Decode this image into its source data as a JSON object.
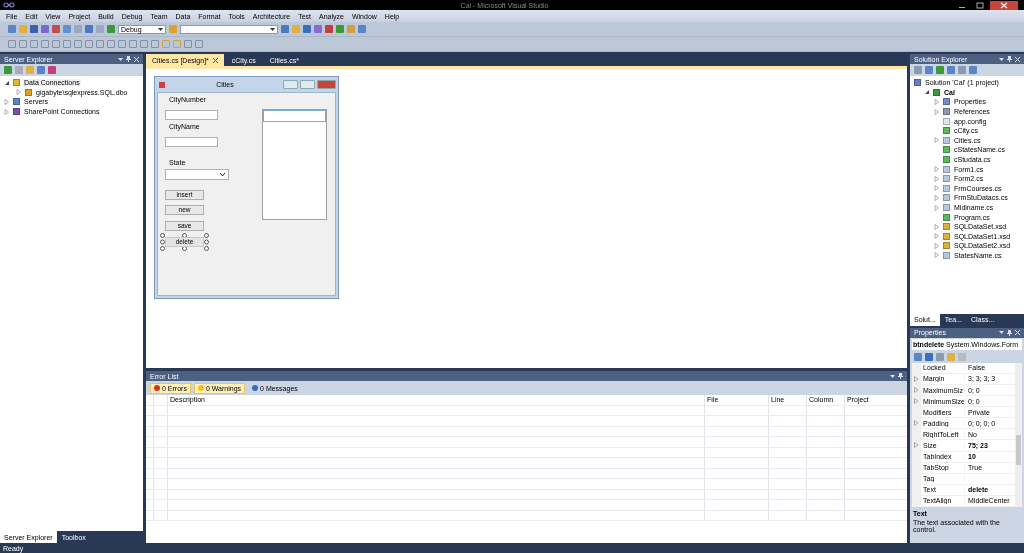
{
  "window": {
    "title": "Cal - Microsoft Visual Studio"
  },
  "menu": [
    "File",
    "Edit",
    "View",
    "Project",
    "Build",
    "Debug",
    "Team",
    "Data",
    "Format",
    "Tools",
    "Architecture",
    "Test",
    "Analyze",
    "Window",
    "Help"
  ],
  "toolbar": {
    "configuration": "Debug"
  },
  "server_explorer": {
    "title": "Server Explorer",
    "tree": [
      {
        "label": "Data Connections",
        "kind": "database",
        "expanded": true,
        "selected": true,
        "children": [
          {
            "label": "gigabyte\\sqlexpress.SQL.dbo",
            "kind": "connection",
            "expanded": false,
            "selected": false
          }
        ]
      },
      {
        "label": "Servers",
        "kind": "server",
        "expanded": false,
        "selected": false
      },
      {
        "label": "SharePoint Connections",
        "kind": "sharepoint",
        "expanded": false,
        "selected": false
      }
    ],
    "bottom_tabs": [
      {
        "label": "Server Explorer",
        "selected": true
      },
      {
        "label": "Toolbox",
        "selected": false
      }
    ]
  },
  "document_tabs": [
    {
      "label": "Cities.cs [Design]*",
      "selected": true
    },
    {
      "label": "cCity.cs",
      "selected": false
    },
    {
      "label": "Cities.cs*",
      "selected": false
    }
  ],
  "form": {
    "title": "Cities",
    "labels": [
      "CityNumber",
      "CityName",
      "State"
    ],
    "buttons": [
      {
        "label": "insert",
        "selected": false
      },
      {
        "label": "new",
        "selected": false
      },
      {
        "label": "save",
        "selected": false
      },
      {
        "label": "delete",
        "selected": true
      }
    ]
  },
  "error_list": {
    "title": "Error List",
    "filters": [
      {
        "label": "0 Errors",
        "kind": "error",
        "selected": true
      },
      {
        "label": "0 Warnings",
        "kind": "warning",
        "selected": true
      },
      {
        "label": "0 Messages",
        "kind": "info",
        "selected": false
      }
    ],
    "columns": [
      "Description",
      "File",
      "Line",
      "Column",
      "Project"
    ]
  },
  "solution_explorer": {
    "title": "Solution Explorer",
    "tree": [
      {
        "label": "Solution 'Cal' (1 project)",
        "kind": "solution",
        "children": [
          {
            "label": "Cal",
            "kind": "project",
            "expanded": true,
            "children": [
              {
                "label": "Properties",
                "kind": "properties",
                "expanded": false
              },
              {
                "label": "References",
                "kind": "references",
                "expanded": false
              },
              {
                "label": "app.config",
                "kind": "config"
              },
              {
                "label": "cCity.cs",
                "kind": "cs"
              },
              {
                "label": "Cities.cs",
                "kind": "form",
                "expanded": false
              },
              {
                "label": "cStatesName.cs",
                "kind": "cs"
              },
              {
                "label": "cStudata.cs",
                "kind": "cs"
              },
              {
                "label": "Form1.cs",
                "kind": "form",
                "expanded": false
              },
              {
                "label": "Form2.cs",
                "kind": "form",
                "expanded": false
              },
              {
                "label": "FrmCourses.cs",
                "kind": "form",
                "expanded": false
              },
              {
                "label": "FrmStuDatacs.cs",
                "kind": "form",
                "expanded": false
              },
              {
                "label": "Midiname.cs",
                "kind": "form",
                "expanded": false
              },
              {
                "label": "Program.cs",
                "kind": "cs"
              },
              {
                "label": "SQLDataSet.xsd",
                "kind": "xsd",
                "expanded": false
              },
              {
                "label": "SQLDataSet1.xsd",
                "kind": "xsd",
                "expanded": false
              },
              {
                "label": "SQLDataSet2.xsd",
                "kind": "xsd",
                "expanded": false
              },
              {
                "label": "StatesName.cs",
                "kind": "form",
                "expanded": false
              }
            ]
          }
        ]
      }
    ],
    "bottom_tabs": [
      {
        "label": "Solut...",
        "selected": true
      },
      {
        "label": "Tea...",
        "selected": false
      },
      {
        "label": "Class...",
        "selected": false
      }
    ]
  },
  "properties": {
    "title": "Properties",
    "object": "btndelete",
    "type": "System.Windows.Form",
    "rows": [
      {
        "name": "Locked",
        "value": "False",
        "expandable": false,
        "bold": false
      },
      {
        "name": "Margin",
        "value": "3; 3; 3; 3",
        "expandable": true,
        "bold": false
      },
      {
        "name": "MaximumSiz",
        "value": "0; 0",
        "expandable": true,
        "bold": false
      },
      {
        "name": "MinimumSize",
        "value": "0; 0",
        "expandable": true,
        "bold": false
      },
      {
        "name": "Modifiers",
        "value": "Private",
        "expandable": false,
        "bold": false
      },
      {
        "name": "Padding",
        "value": "0; 0; 0; 0",
        "expandable": true,
        "bold": false
      },
      {
        "name": "RightToLeft",
        "value": "No",
        "expandable": false,
        "bold": false
      },
      {
        "name": "Size",
        "value": "75; 23",
        "expandable": true,
        "bold": true
      },
      {
        "name": "TabIndex",
        "value": "10",
        "expandable": false,
        "bold": true
      },
      {
        "name": "TabStop",
        "value": "True",
        "expandable": false,
        "bold": false
      },
      {
        "name": "Tag",
        "expandable": false
      },
      {
        "name": "Text",
        "value": "delete",
        "expandable": false,
        "bold": true
      },
      {
        "name": "TextAlign",
        "value": "MiddleCenter",
        "expandable": false,
        "bold": false
      }
    ],
    "description_title": "Text",
    "description": "The text associated with the control."
  },
  "status_bar": {
    "text": "Ready"
  }
}
